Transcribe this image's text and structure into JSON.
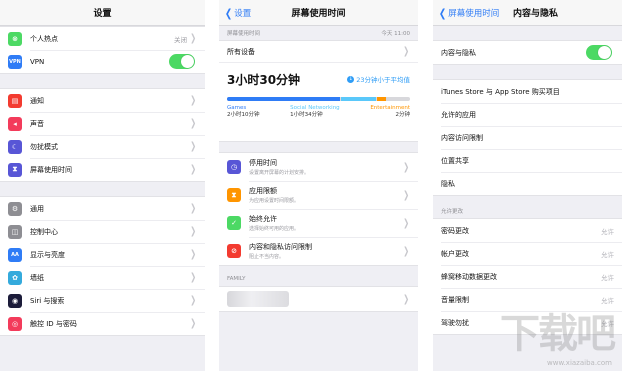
{
  "panel1": {
    "title": "设置",
    "rows_group1": [
      {
        "icon": "hotspot-icon",
        "color": "#4cd964",
        "glyph": "⊗",
        "label": "个人热点",
        "value": "关闭"
      },
      {
        "icon": "vpn-icon",
        "color": "#2f7cf6",
        "glyph": "VPN",
        "label": "VPN"
      }
    ],
    "rows_group2": [
      {
        "icon": "notifications-icon",
        "color": "#f33b30",
        "glyph": "▤",
        "label": "通知"
      },
      {
        "icon": "sounds-icon",
        "color": "#f33b5b",
        "glyph": "◂",
        "label": "声音"
      },
      {
        "icon": "do-not-disturb-icon",
        "color": "#5856d6",
        "glyph": "☾",
        "label": "勿扰模式"
      },
      {
        "icon": "screen-time-icon",
        "color": "#5856d6",
        "glyph": "⧗",
        "label": "屏幕使用时间"
      }
    ],
    "rows_group3": [
      {
        "icon": "general-icon",
        "color": "#8e8e93",
        "glyph": "⚙",
        "label": "通用"
      },
      {
        "icon": "control-center-icon",
        "color": "#8e8e93",
        "glyph": "◫",
        "label": "控制中心"
      },
      {
        "icon": "display-brightness-icon",
        "color": "#2f7cf6",
        "glyph": "AA",
        "label": "显示与亮度"
      },
      {
        "icon": "wallpaper-icon",
        "color": "#34aadc",
        "glyph": "✿",
        "label": "墙纸"
      },
      {
        "icon": "siri-icon",
        "color": "#1c1c3a",
        "glyph": "◉",
        "label": "Siri 与搜索"
      },
      {
        "icon": "touch-id-icon",
        "color": "#f33b5b",
        "glyph": "◎",
        "label": "触控 ID 与密码"
      }
    ]
  },
  "panel2": {
    "back_label": "设置",
    "title": "屏幕使用时间",
    "section_label": "屏幕使用时间",
    "section_time": "今天 11:00",
    "all_devices": "所有设备",
    "total": "3小时30分钟",
    "avg": "23分钟小于平均值",
    "bar": [
      {
        "name": "Games",
        "time": "2小时10分钟",
        "color": "#2f7cf6",
        "fraction": 0.62
      },
      {
        "name": "Social Networking",
        "time": "1小时34分钟",
        "color": "#5ac8fa",
        "fraction": 0.19
      },
      {
        "name": "Entertainment",
        "time": "2分钟",
        "color": "#ff9500",
        "fraction": 0.05
      }
    ],
    "details": [
      {
        "icon": "downtime-icon",
        "color": "#5856d6",
        "glyph": "◷",
        "title": "停用时间",
        "sub": "设置离开屏幕的计划安排。"
      },
      {
        "icon": "app-limits-icon",
        "color": "#ff9500",
        "glyph": "⧗",
        "title": "应用限额",
        "sub": "为应用设置时间限额。"
      },
      {
        "icon": "always-allowed-icon",
        "color": "#4cd964",
        "glyph": "✓",
        "title": "始终允许",
        "sub": "选择始终可用的应用。"
      },
      {
        "icon": "content-restrictions-icon",
        "color": "#f33b30",
        "glyph": "⊘",
        "title": "内容和隐私访问限制",
        "sub": "阻止不当内容。"
      }
    ],
    "family_label": "FAMILY"
  },
  "panel3": {
    "back_label": "屏幕使用时间",
    "title": "内容与隐私",
    "toggle_label": "内容与隐私",
    "rows": [
      "iTunes Store 与 App Store 购买项目",
      "允许的应用",
      "内容访问限制",
      "位置共享",
      "隐私"
    ],
    "section_label": "允许更改",
    "allow_rows": [
      {
        "label": "密码更改",
        "value": "允许"
      },
      {
        "label": "帐户更改",
        "value": "允许"
      },
      {
        "label": "蜂窝移动数据更改",
        "value": "允许"
      },
      {
        "label": "音量限制",
        "value": "允许"
      },
      {
        "label": "驾驶勿扰",
        "value": "允许"
      }
    ]
  },
  "watermark": {
    "text": "下载吧",
    "url": "www.xiazaiba.com"
  }
}
